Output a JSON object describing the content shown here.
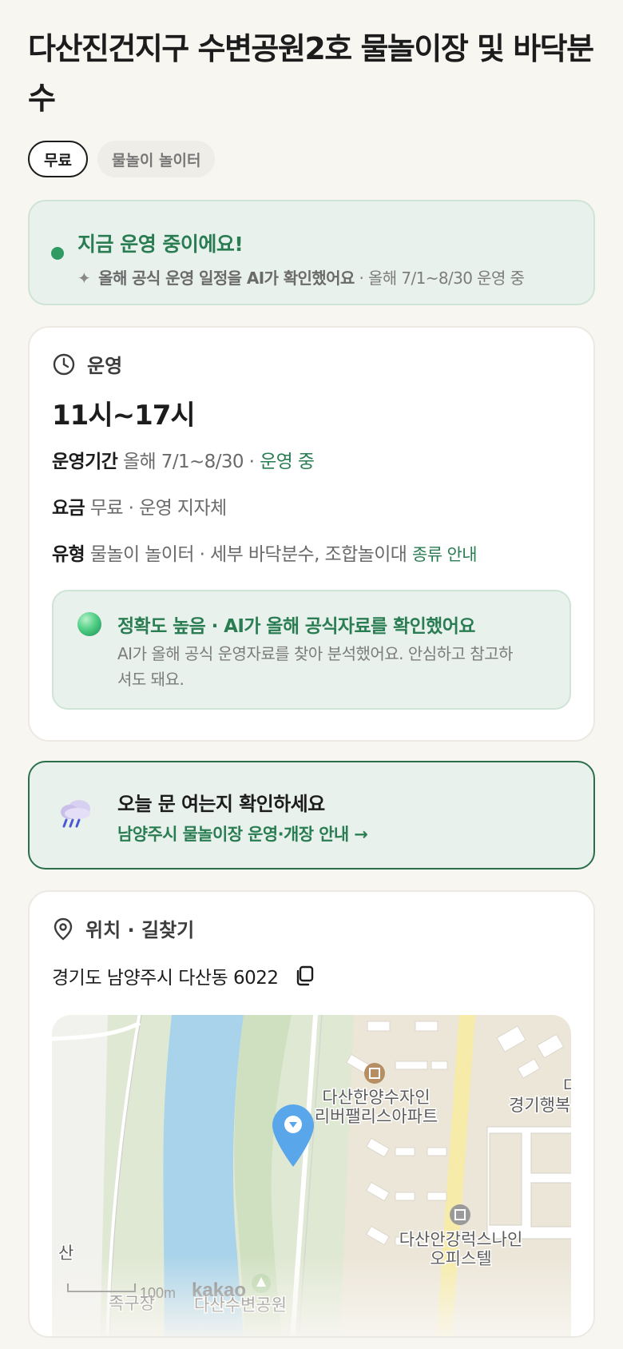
{
  "title": "다산진건지구 수변공원2호 물놀이장 및 바닥분수",
  "tags": [
    "무료",
    "물놀이 놀이터"
  ],
  "status": {
    "title": "지금 운영 중이에요!",
    "sub_strong": "올해 공식 운영 일정을 AI가 확인했어요",
    "sub_rest": " · 올해 7/1~8/30 운영 중",
    "dot_color": "#2e9b63"
  },
  "operation": {
    "section_label": "운영",
    "icon": "clock-icon",
    "hours": "11시~17시",
    "period_key": "운영기간",
    "period_value": " 올해 7/1~8/30 · ",
    "period_status": "운영 중",
    "fee_key": "요금",
    "fee_value": " 무료 · 운영 지자체",
    "type_key": "유형",
    "type_value": " 물놀이 놀이터 · 세부 바닥분수, 조합놀이대 ",
    "type_link": "종류 안내",
    "accuracy_title": "정확도 높음 · AI가 올해 공식자료를 확인했어요",
    "accuracy_desc": "AI가 올해 공식 운영자료를 찾아 분석했어요. 안심하고 참고하셔도 돼요."
  },
  "weather": {
    "icon": "rain-cloud-icon",
    "title": "오늘 문 여는지 확인하세요",
    "link": "남양주시 물놀이장 운영·개장 안내 →"
  },
  "location": {
    "section_label": "위치 · 길찾기",
    "icon": "location-pin-icon",
    "address": "경기도 남양주시 다산동 6022",
    "copy_icon": "copy-icon",
    "map_labels": {
      "apt1_line1": "다산한양수자인",
      "apt1_line2": "리버팰리스아파트",
      "apt2_line1": "다",
      "apt2_line2": "경기행복",
      "office_line1": "다산안강럭스나인",
      "office_line2": "오피스텔",
      "left_edge": "산",
      "scale": "100m",
      "brand": "kakao",
      "bottom1": "족구장",
      "bottom2": "다산수변공원"
    }
  },
  "colors": {
    "accent_green": "#2a7d52",
    "river": "#a9d3ea",
    "marker": "#5aa6ea"
  }
}
